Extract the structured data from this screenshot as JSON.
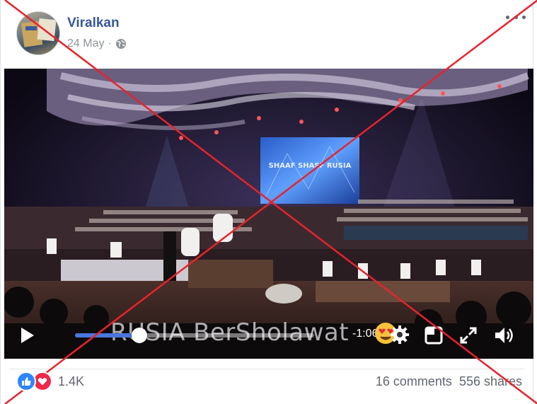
{
  "post": {
    "author": "Viralkan",
    "date": "24 May",
    "separator": "·",
    "privacy_icon": "globe-icon",
    "options_icon": "more-horizontal-icon"
  },
  "video": {
    "caption": "RUSIA BerSholawat",
    "screen_text": "SHAAF SHASF RUSIA",
    "time_remaining": "-1:06",
    "progress": 0.27,
    "icons": [
      "play-icon",
      "settings-gear-icon",
      "pip-icon",
      "fullscreen-icon",
      "volume-icon"
    ],
    "accent_color": "#4a76dd"
  },
  "footer": {
    "reaction_icons": [
      "like-icon",
      "love-icon"
    ],
    "reaction_count": "1.4K",
    "comments": "16 comments",
    "shares": "556 shares"
  },
  "overlay": {
    "mark": "red-cross",
    "color": "#e8232b"
  }
}
